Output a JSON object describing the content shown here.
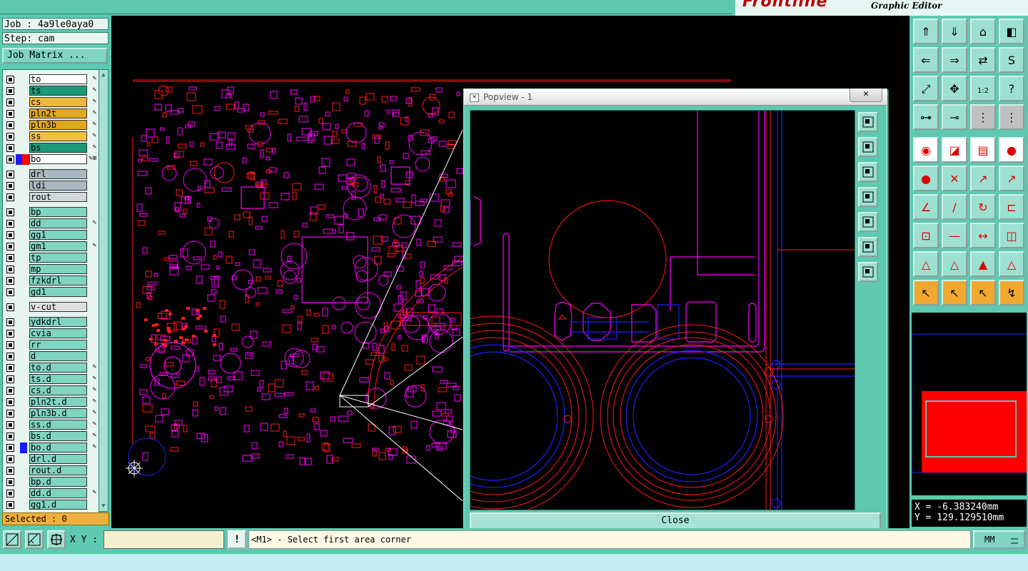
{
  "brand": {
    "logo": "Frontline",
    "subtitle": "Graphic Editor"
  },
  "job": {
    "job_label": "Job : 4a9le0aya0",
    "step_label": "Step: cam",
    "matrix_button": "Job Matrix ..."
  },
  "layers": [
    {
      "name": "to",
      "color": "#ffffff",
      "mark": "✎",
      "sep": false
    },
    {
      "name": "ts",
      "color": "#1a9a7a",
      "mark": "✎",
      "sep": false
    },
    {
      "name": "cs",
      "color": "#f0b838",
      "mark": "✎",
      "sep": false
    },
    {
      "name": "pln2t",
      "color": "#e0a820",
      "mark": "✎",
      "sep": false
    },
    {
      "name": "pln3b",
      "color": "#e0a820",
      "mark": "✎",
      "sep": false
    },
    {
      "name": "ss",
      "color": "#f0c040",
      "mark": "✎",
      "sep": false
    },
    {
      "name": "bs",
      "color": "#1a9a7a",
      "mark": "✎",
      "sep": false
    },
    {
      "name": "bo",
      "color": "#ffffff",
      "mark": "✎⊞",
      "sep": false,
      "active": true,
      "swatch": "#ff0000"
    },
    {
      "name": "drl",
      "color": "#a8b8c0",
      "mark": "",
      "sep": true
    },
    {
      "name": "ldi",
      "color": "#a8b8c0",
      "mark": "",
      "sep": false
    },
    {
      "name": "rout",
      "color": "#d0d8dc",
      "mark": "",
      "sep": false
    },
    {
      "name": "bp",
      "color": "#7fd4c2",
      "mark": "",
      "sep": true
    },
    {
      "name": "dd",
      "color": "#7fd4c2",
      "mark": "✎",
      "sep": false
    },
    {
      "name": "gg1",
      "color": "#7fd4c2",
      "mark": "",
      "sep": false
    },
    {
      "name": "gm1",
      "color": "#7fd4c2",
      "mark": "✎",
      "sep": false
    },
    {
      "name": "tp",
      "color": "#7fd4c2",
      "mark": "",
      "sep": false
    },
    {
      "name": "mp",
      "color": "#7fd4c2",
      "mark": "",
      "sep": false
    },
    {
      "name": "fzkdrl",
      "color": "#7fd4c2",
      "mark": "",
      "sep": false
    },
    {
      "name": "gd1",
      "color": "#7fd4c2",
      "mark": "",
      "sep": false
    },
    {
      "name": "v-cut",
      "color": "#e0e0e0",
      "mark": "",
      "sep": true
    },
    {
      "name": "ydkdrl",
      "color": "#7fd4c2",
      "mark": "",
      "sep": true
    },
    {
      "name": "cvia",
      "color": "#7fd4c2",
      "mark": "",
      "sep": false
    },
    {
      "name": "rr",
      "color": "#7fd4c2",
      "mark": "",
      "sep": false
    },
    {
      "name": "d",
      "color": "#7fd4c2",
      "mark": "",
      "sep": false
    },
    {
      "name": "to.d",
      "color": "#7fd4c2",
      "mark": "✎",
      "sep": false
    },
    {
      "name": "ts.d",
      "color": "#7fd4c2",
      "mark": "✎",
      "sep": false
    },
    {
      "name": "cs.d",
      "color": "#7fd4c2",
      "mark": "✎",
      "sep": false
    },
    {
      "name": "pln2t.d",
      "color": "#7fd4c2",
      "mark": "✎",
      "sep": false
    },
    {
      "name": "pln3b.d",
      "color": "#7fd4c2",
      "mark": "✎",
      "sep": false
    },
    {
      "name": "ss.d",
      "color": "#7fd4c2",
      "mark": "✎",
      "sep": false
    },
    {
      "name": "bs.d",
      "color": "#7fd4c2",
      "mark": "✎",
      "sep": false
    },
    {
      "name": "bo.d",
      "color": "#7fd4c2",
      "mark": "✎",
      "sep": false,
      "swatch": "#1a1aff"
    },
    {
      "name": "drl.d",
      "color": "#7fd4c2",
      "mark": "",
      "sep": false
    },
    {
      "name": "rout.d",
      "color": "#7fd4c2",
      "mark": "",
      "sep": false
    },
    {
      "name": "bp.d",
      "color": "#7fd4c2",
      "mark": "",
      "sep": false
    },
    {
      "name": "dd.d",
      "color": "#7fd4c2",
      "mark": "✎",
      "sep": false
    },
    {
      "name": "gg1.d",
      "color": "#7fd4c2",
      "mark": "",
      "sep": false
    }
  ],
  "selected_label": "Selected : 0",
  "popup": {
    "title": "Popview - 1",
    "close_x": "✕",
    "close_label": "Close"
  },
  "coords": {
    "x": "X = -6.383240mm",
    "y": "Y = 129.129510mm"
  },
  "bottom": {
    "xy_label": "X Y :",
    "xy_value": "",
    "bang": "!",
    "status": "<M1> - Select first area corner",
    "unit": "MM"
  },
  "colors": {
    "accent": "#5ec8b0",
    "copper": "#ff1a1a",
    "silk": "#ff00ff",
    "drill": "#2020ff"
  }
}
